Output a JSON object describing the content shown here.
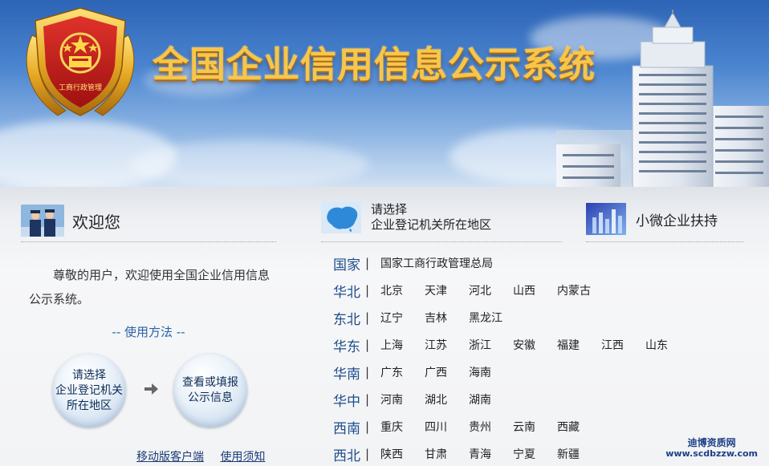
{
  "banner": {
    "title": "全国企业信用信息公示系统",
    "emblem_text": "工商行政管理"
  },
  "welcome": {
    "title": "欢迎您",
    "text": "尊敬的用户，欢迎使用全国企业信用信息公示系统。",
    "howto": "-- 使用方法 --",
    "step1_line1": "请选择",
    "step1_line2": "企业登记机关",
    "step1_line3": "所在地区",
    "step2_line1": "查看或填报",
    "step2_line2": "公示信息",
    "link_mobile": "移动版客户端",
    "link_notice": "使用须知"
  },
  "region_select": {
    "title_line1": "请选择",
    "title_line2": "企业登记机关所在地区",
    "separator": "|",
    "rows": [
      {
        "name": "国家",
        "items": [
          "国家工商行政管理总局"
        ]
      },
      {
        "name": "华北",
        "items": [
          "北京",
          "天津",
          "河北",
          "山西",
          "内蒙古"
        ]
      },
      {
        "name": "东北",
        "items": [
          "辽宁",
          "吉林",
          "黑龙江"
        ]
      },
      {
        "name": "华东",
        "items": [
          "上海",
          "江苏",
          "浙江",
          "安徽",
          "福建",
          "江西",
          "山东"
        ]
      },
      {
        "name": "华南",
        "items": [
          "广东",
          "广西",
          "海南"
        ]
      },
      {
        "name": "华中",
        "items": [
          "河南",
          "湖北",
          "湖南"
        ]
      },
      {
        "name": "西南",
        "items": [
          "重庆",
          "四川",
          "贵州",
          "云南",
          "西藏"
        ]
      },
      {
        "name": "西北",
        "items": [
          "陕西",
          "甘肃",
          "青海",
          "宁夏",
          "新疆"
        ]
      }
    ]
  },
  "micro": {
    "title": "小微企业扶持"
  },
  "watermark": {
    "line1": "迪博资质网",
    "line2": "www.scdbzzw.com"
  },
  "colors": {
    "banner_sky": "#3d74c2",
    "title_gold": "#f7c64a",
    "region_name": "#1e4d8c",
    "link": "#1c3d77"
  }
}
